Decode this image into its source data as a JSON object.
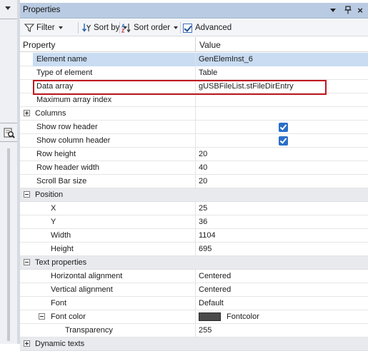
{
  "panel": {
    "title": "Properties",
    "title_buttons": {
      "menu": "▾",
      "pin": "⊥",
      "close": "×"
    }
  },
  "toolbar": {
    "filter_label": "Filter",
    "sort_by_label": "Sort by",
    "sort_order_label": "Sort order",
    "advanced_label": "Advanced",
    "advanced_checked": true
  },
  "grid": {
    "col_property": "Property",
    "col_value": "Value",
    "rows": [
      {
        "label": "Element name",
        "value": "GenElemInst_6"
      },
      {
        "label": "Type of element",
        "value": "Table"
      },
      {
        "label": "Data array",
        "value": "gUSBFileList.stFileDirEntry"
      },
      {
        "label": "Maximum array index",
        "value": ""
      },
      {
        "label": "Columns",
        "value": ""
      },
      {
        "label": "Show row header",
        "value": ""
      },
      {
        "label": "Show column header",
        "value": ""
      },
      {
        "label": "Row height",
        "value": "20"
      },
      {
        "label": "Row header width",
        "value": "40"
      },
      {
        "label": "Scroll Bar size",
        "value": "20"
      },
      {
        "label": "Position",
        "value": ""
      },
      {
        "label": "X",
        "value": "25"
      },
      {
        "label": "Y",
        "value": "36"
      },
      {
        "label": "Width",
        "value": "1104"
      },
      {
        "label": "Height",
        "value": "695"
      },
      {
        "label": "Text properties",
        "value": ""
      },
      {
        "label": "Horizontal alignment",
        "value": "Centered"
      },
      {
        "label": "Vertical alignment",
        "value": "Centered"
      },
      {
        "label": "Font",
        "value": "Default"
      },
      {
        "label": "Font color",
        "value": "Fontcolor"
      },
      {
        "label": "Transparency",
        "value": "255"
      },
      {
        "label": "Dynamic texts",
        "value": ""
      }
    ]
  },
  "colors": {
    "selection": "#c9dcf2",
    "highlight_border": "#c0181f",
    "checkbox": "#2a6fc9",
    "font_color_swatch": "#4a4a4a",
    "titlebar": "#b9cbe2"
  },
  "icons": {
    "filter": "funnel-icon",
    "sort_by": "sort-by-icon",
    "sort_order": "sort-az-icon",
    "left_panel": "find-icon"
  }
}
